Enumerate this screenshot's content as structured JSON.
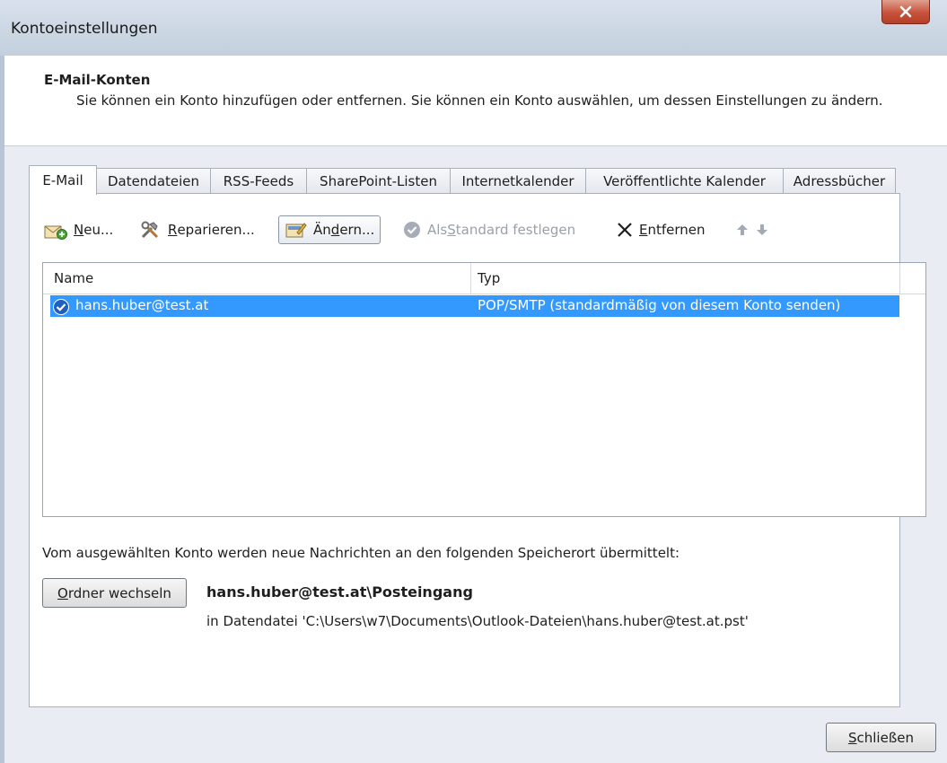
{
  "window": {
    "title": "Kontoeinstellungen"
  },
  "header": {
    "title": "E-Mail-Konten",
    "description": "Sie können ein Konto hinzufügen oder entfernen. Sie können ein Konto auswählen, um dessen Einstellungen zu ändern."
  },
  "tabs": [
    {
      "label": "E-Mail",
      "active": true
    },
    {
      "label": "Datendateien"
    },
    {
      "label": "RSS-Feeds"
    },
    {
      "label": "SharePoint-Listen"
    },
    {
      "label": "Internetkalender"
    },
    {
      "label": "Veröffentlichte Kalender"
    },
    {
      "label": "Adressbücher"
    }
  ],
  "toolbar": {
    "new_label_u": "N",
    "new_label_rest": "eu...",
    "repair_label_u": "R",
    "repair_label_rest": "eparieren...",
    "change_label_a": "Än",
    "change_label_u": "d",
    "change_label_rest": "ern...",
    "default_label_a": "Als ",
    "default_label_u": "S",
    "default_label_rest": "tandard festlegen",
    "remove_label_u": "E",
    "remove_label_rest": "ntfernen"
  },
  "accounts_table": {
    "columns": [
      "Name",
      "Typ"
    ],
    "rows": [
      {
        "name": "hans.huber@test.at",
        "type": "POP/SMTP (standardmäßig von diesem Konto senden)",
        "selected": true
      }
    ]
  },
  "delivery": {
    "info": "Vom ausgewählten Konto werden neue Nachrichten an den folgenden Speicherort übermittelt:",
    "change_folder_u": "O",
    "change_folder_rest": "rdner wechseln",
    "folder": "hans.huber@test.at\\Posteingang",
    "datafile": "in Datendatei 'C:\\Users\\w7\\Documents\\Outlook-Dateien\\hans.huber@test.at.pst'"
  },
  "footer": {
    "close_u": "S",
    "close_rest": "chließen"
  },
  "colors": {
    "selection": "#3399ff",
    "close_button": "#c7523c"
  }
}
